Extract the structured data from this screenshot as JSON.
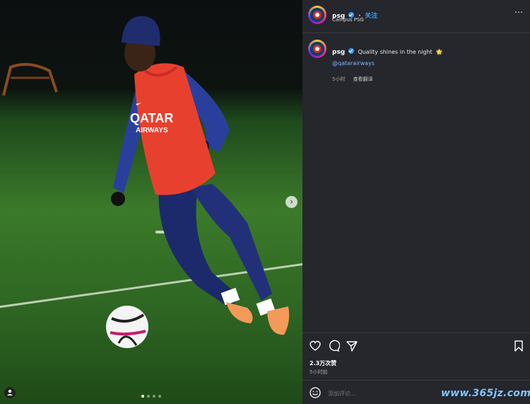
{
  "post": {
    "username": "psg",
    "follow_label": "关注",
    "location": "Campus PSG",
    "more_icon": "more-horizontal-icon"
  },
  "caption": {
    "username": "psg",
    "text": "Quality shines in the night",
    "emoji": "🌟",
    "mention": "@qatarairways",
    "time": "5小时",
    "translate_label": "查看翻译"
  },
  "actions": {
    "icons": [
      "heart-icon",
      "comment-icon",
      "share-icon",
      "bookmark-icon"
    ],
    "views": "2.3万次赞",
    "time": "5小时前"
  },
  "comment": {
    "placeholder": "添加评论..."
  },
  "media": {
    "bib_text_1": "QATAR",
    "bib_text_2": "AIRWAYS",
    "slide_count": 4,
    "active_slide": 0
  },
  "watermark": "www.365jz.com"
}
